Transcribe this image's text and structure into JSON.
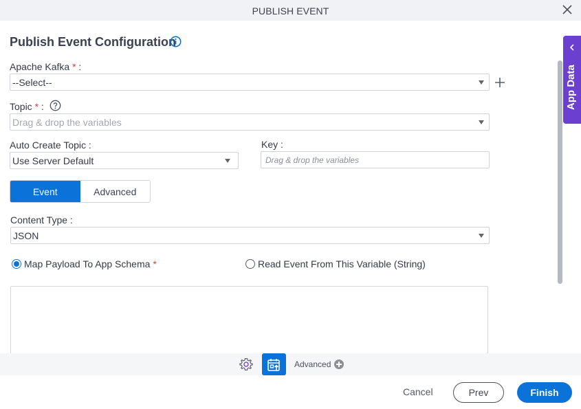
{
  "window": {
    "title": "PUBLISH EVENT",
    "close_icon": "close-icon"
  },
  "form": {
    "section_title": "Publish Event Configuration",
    "info_icon": "info-icon",
    "apache_kafka": {
      "label": "Apache Kafka",
      "required_mark": "*",
      "suffix": ":",
      "value": "--Select--",
      "add_icon": "plus-icon"
    },
    "topic": {
      "label": "Topic",
      "required_mark": "*",
      "suffix": ":",
      "help_icon": "help-icon",
      "placeholder": "Drag & drop the variables"
    },
    "auto_create_topic": {
      "label": "Auto Create Topic :",
      "value": "Use Server Default"
    },
    "key": {
      "label": "Key :",
      "placeholder": "Drag & drop the variables"
    },
    "tabs": [
      {
        "label": "Event",
        "active": true
      },
      {
        "label": "Advanced",
        "active": false
      }
    ],
    "content_type": {
      "label": "Content Type :",
      "value": "JSON"
    },
    "payload_options": [
      {
        "label": "Map Payload To App Schema",
        "required_mark": "*",
        "selected": true
      },
      {
        "label": "Read Event From This Variable (String)",
        "selected": false
      }
    ]
  },
  "side_panel": {
    "label": "App Data",
    "icon": "chevron-left-icon"
  },
  "toolbar": {
    "settings_icon": "gear-icon",
    "calendar_icon": "calendar-upload-icon",
    "advanced_label": "Advanced",
    "advanced_icon": "plus-circle-icon"
  },
  "footer": {
    "cancel_label": "Cancel",
    "prev_label": "Prev",
    "finish_label": "Finish"
  },
  "colors": {
    "primary": "#0a72d8",
    "app_data_panel": "#6b3fcf",
    "required": "#d9413b",
    "titlebar_bg": "#f1f2f5"
  }
}
